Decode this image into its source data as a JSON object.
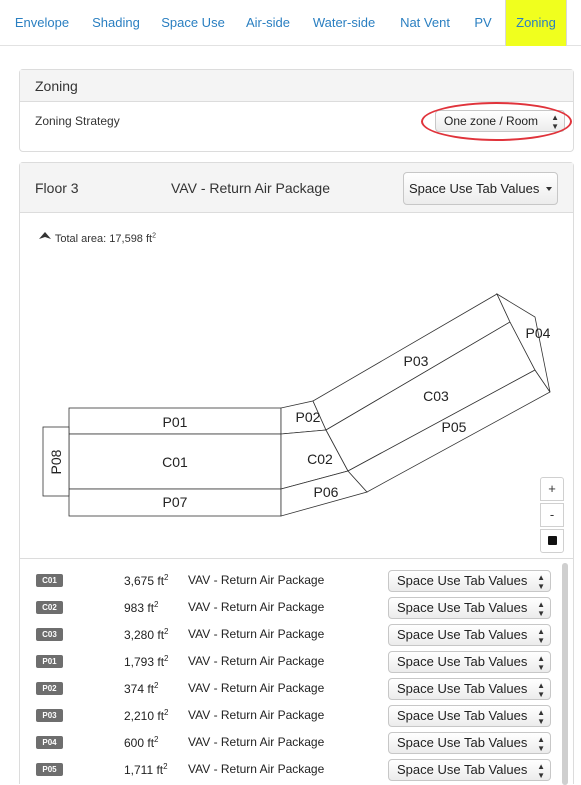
{
  "tabs": [
    {
      "label": "Envelope"
    },
    {
      "label": "Shading"
    },
    {
      "label": "Space Use"
    },
    {
      "label": "Air-side"
    },
    {
      "label": "Water-side"
    },
    {
      "label": "Nat Vent"
    },
    {
      "label": "PV"
    },
    {
      "label": "Zoning",
      "active": true
    }
  ],
  "zoning": {
    "title": "Zoning",
    "strategy_label": "Zoning Strategy",
    "strategy_value": "One zone / Room"
  },
  "floor": {
    "name": "Floor 3",
    "system": "VAV - Return Air Package",
    "selector_value": "Space Use Tab Values",
    "north_label": "N",
    "total_area": "Total area: 17,598 ft",
    "total_area_unit_exp": "2",
    "zoom_in": "+",
    "zoom_out": "-",
    "plan_labels": {
      "p01": "P01",
      "c01": "C01",
      "p07": "P07",
      "p08": "P08",
      "p02": "P02",
      "c02": "C02",
      "p06": "P06",
      "p03": "P03",
      "c03": "C03",
      "p05": "P05",
      "p04": "P04"
    }
  },
  "zones": [
    {
      "id": "C01",
      "area": "3,675 ft",
      "system": "VAV - Return Air Package",
      "value": "Space Use Tab Values"
    },
    {
      "id": "C02",
      "area": "983 ft",
      "system": "VAV - Return Air Package",
      "value": "Space Use Tab Values"
    },
    {
      "id": "C03",
      "area": "3,280 ft",
      "system": "VAV - Return Air Package",
      "value": "Space Use Tab Values"
    },
    {
      "id": "P01",
      "area": "1,793 ft",
      "system": "VAV - Return Air Package",
      "value": "Space Use Tab Values"
    },
    {
      "id": "P02",
      "area": "374 ft",
      "system": "VAV - Return Air Package",
      "value": "Space Use Tab Values"
    },
    {
      "id": "P03",
      "area": "2,210 ft",
      "system": "VAV - Return Air Package",
      "value": "Space Use Tab Values"
    },
    {
      "id": "P04",
      "area": "600 ft",
      "system": "VAV - Return Air Package",
      "value": "Space Use Tab Values"
    },
    {
      "id": "P05",
      "area": "1,711 ft",
      "system": "VAV - Return Air Package",
      "value": "Space Use Tab Values"
    }
  ],
  "unit_exp": "2",
  "colors": {
    "active_tab": "#f0ff1e",
    "link": "#2a7fc1",
    "highlight_oval": "#e0333b"
  }
}
